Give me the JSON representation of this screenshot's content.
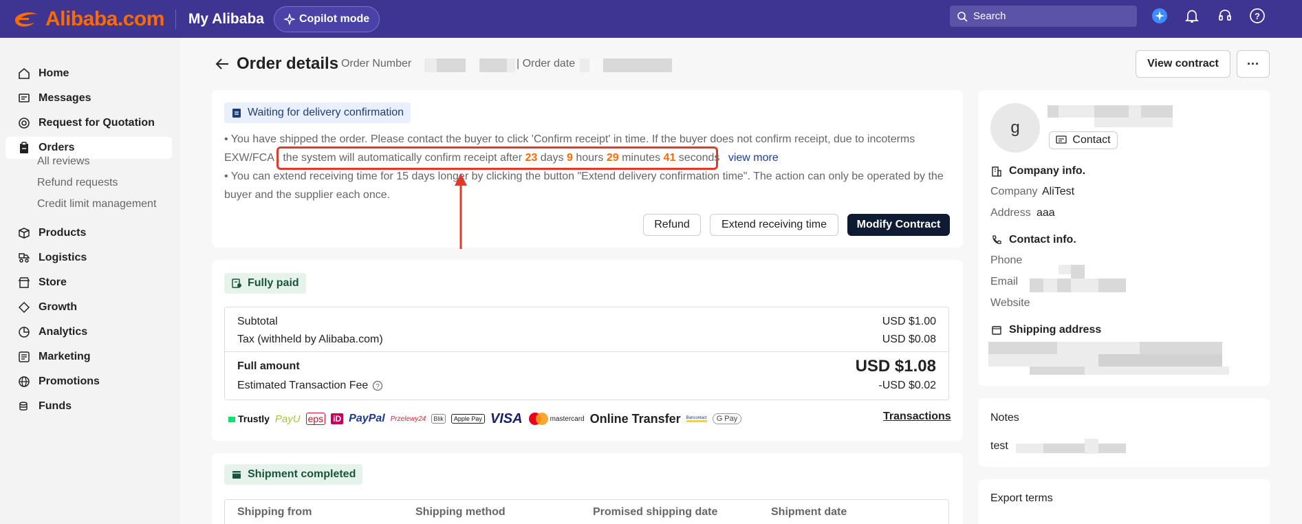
{
  "header": {
    "brand": "Alibaba.com",
    "section": "My Alibaba",
    "copilot_label": "Copilot mode",
    "search_placeholder": "Search",
    "colors": {
      "bar": "#3d3591",
      "brand": "#ff6a00"
    }
  },
  "sidebar": {
    "items": [
      {
        "label": "Home",
        "icon": "home-icon"
      },
      {
        "label": "Messages",
        "icon": "message-icon"
      },
      {
        "label": "Request for Quotation",
        "icon": "target-icon"
      },
      {
        "label": "Orders",
        "icon": "clipboard-icon",
        "active": true
      },
      {
        "label": "Products",
        "icon": "box-icon"
      },
      {
        "label": "Logistics",
        "icon": "truck-icon"
      },
      {
        "label": "Store",
        "icon": "store-icon"
      },
      {
        "label": "Growth",
        "icon": "growth-icon"
      },
      {
        "label": "Analytics",
        "icon": "pie-chart-icon"
      },
      {
        "label": "Marketing",
        "icon": "marketing-icon"
      },
      {
        "label": "Promotions",
        "icon": "globe-icon"
      },
      {
        "label": "Funds",
        "icon": "coins-icon"
      }
    ],
    "sub_items": [
      "All reviews",
      "Refund requests",
      "Credit limit management"
    ]
  },
  "order": {
    "title": "Order details",
    "number_label": "Order Number",
    "date_label": "| Order date",
    "view_contract": "View contract",
    "more": "···"
  },
  "status": {
    "tag": "Waiting for delivery confirmation",
    "line1_a": "• You have shipped the order. Please contact the buyer to click 'Confirm receipt' in time. If the buyer does not confirm receipt, due to incoterms",
    "line1_b": "EXW/FCA , the system will automatically confirm receipt after",
    "days": "23",
    "days_label": "days",
    "hours": "9",
    "hours_label": "hours",
    "minutes": "29",
    "minutes_label": "minutes",
    "seconds": "41",
    "seconds_label": "seconds",
    "view_more": "view more",
    "line2_a": "• You can extend receiving time for 15 days longer by clicking the button \"Extend delivery confirmation time\". The action can only be operated by the",
    "line2_b": "buyer and the supplier each once.",
    "btn_refund": "Refund",
    "btn_extend": "Extend receiving time",
    "btn_modify": "Modify Contract"
  },
  "payment": {
    "tag": "Fully paid",
    "subtotal_label": "Subtotal",
    "subtotal": "USD $1.00",
    "tax_label": "Tax (withheld by Alibaba.com)",
    "tax": "USD $0.08",
    "full_label": "Full amount",
    "full": "USD $1.08",
    "fee_label": "Estimated Transaction Fee",
    "fee": "-USD $0.02",
    "methods": [
      "Trustly",
      "PayU",
      "eps",
      "iD",
      "PayPal",
      "Przelewy24",
      "Blik",
      "Apple Pay",
      "VISA",
      "mastercard",
      "Online Transfer",
      "Bancontact",
      "G Pay"
    ],
    "transactions": "Transactions"
  },
  "shipment": {
    "tag": "Shipment completed",
    "columns": [
      "Shipping from",
      "Shipping method",
      "Promised shipping date",
      "Shipment date"
    ]
  },
  "buyer": {
    "avatar": "g",
    "contact": "Contact",
    "company_head": "Company info.",
    "company_label": "Company",
    "company": "AliTest",
    "address_label": "Address",
    "address": "aaa",
    "contact_head": "Contact info.",
    "phone_label": "Phone",
    "email_label": "Email",
    "website_label": "Website",
    "shipping_head": "Shipping address"
  },
  "notes": {
    "title": "Notes",
    "value": "test"
  },
  "export": {
    "title": "Export terms"
  }
}
